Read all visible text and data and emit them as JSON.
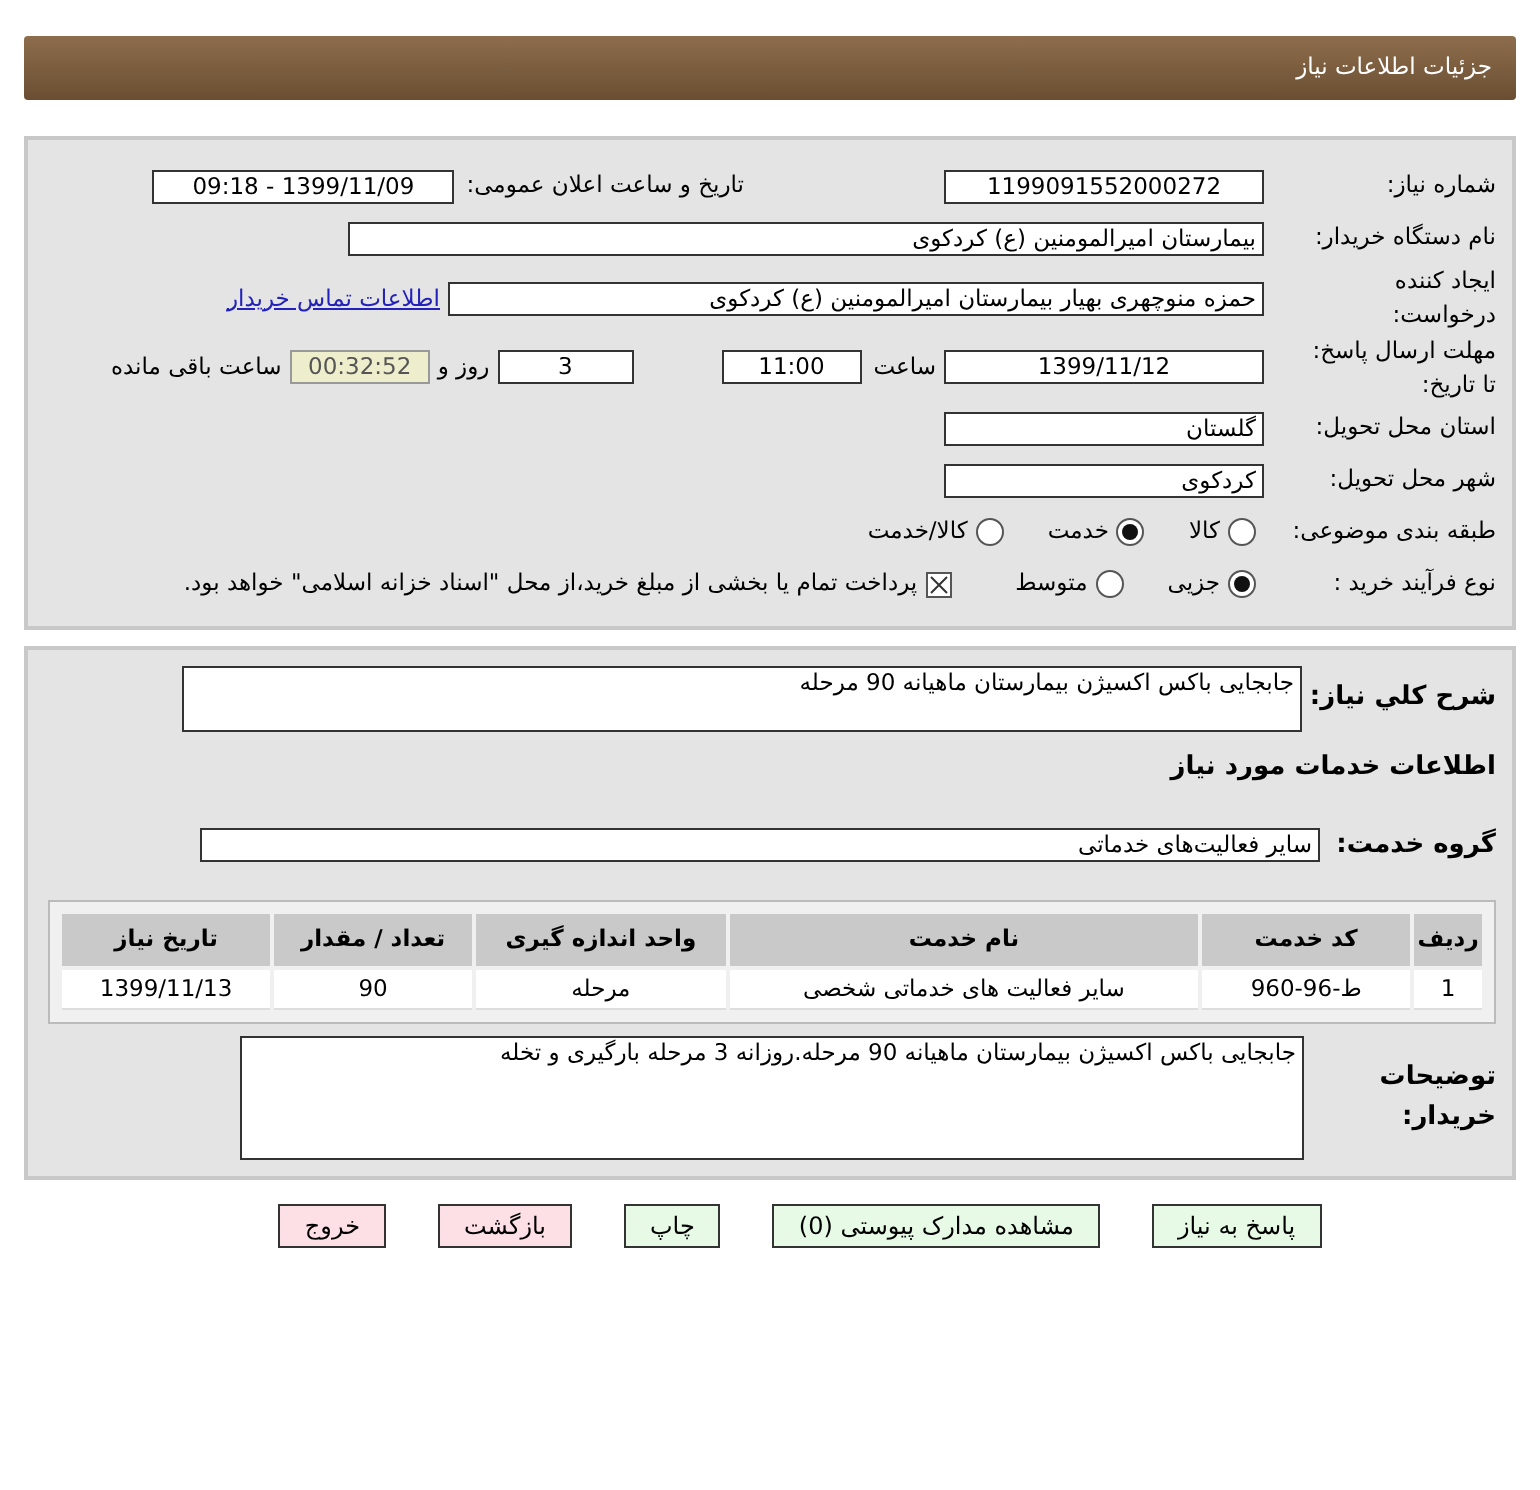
{
  "header": {
    "title": "جزئیات اطلاعات نیاز"
  },
  "need_number": {
    "label": "شماره نیاز:",
    "value": "1199091552000272"
  },
  "announce_date": {
    "label": "تاریخ و ساعت اعلان عمومی:",
    "value": "1399/11/09 - 09:18"
  },
  "buyer_org": {
    "label": "نام دستگاه خریدار:",
    "value": "بیمارستان امیرالمومنین (ع) کردکوی"
  },
  "requester": {
    "label_lines": [
      "ایجاد کننده",
      "درخواست:"
    ],
    "value": "حمزه  منوچهری بهیار بیمارستان امیرالمومنین (ع) کردکوی",
    "link": "اطلاعات تماس خریدار"
  },
  "deadline": {
    "label_lines": [
      "مهلت ارسال پاسخ:",
      "تا تاریخ:"
    ],
    "date": "1399/11/12",
    "time_label": "ساعت",
    "time": "11:00",
    "days": "3",
    "days_label": "روز و",
    "remaining": "00:32:52",
    "remaining_label": "ساعت باقی مانده"
  },
  "province": {
    "label": "استان محل تحویل:",
    "value": "گلستان"
  },
  "city": {
    "label": "شهر محل تحویل:",
    "value": "کردکوی"
  },
  "category": {
    "label": "طبقه بندی موضوعی:",
    "options": [
      {
        "label": "کالا",
        "selected": false
      },
      {
        "label": "خدمت",
        "selected": true
      },
      {
        "label": "کالا/خدمت",
        "selected": false
      }
    ]
  },
  "process": {
    "label": "نوع فرآیند خرید :",
    "options": [
      {
        "label": "جزیی",
        "selected": true
      },
      {
        "label": "متوسط",
        "selected": false
      }
    ],
    "payment": {
      "checked": true,
      "text": "پرداخت تمام یا بخشی از مبلغ خرید،از محل \"اسناد خزانه اسلامی\" خواهد بود."
    }
  },
  "description": {
    "label": "شرح كلي نياز:",
    "value": "جابجایی باکس اکسیژن بیمارستان ماهیانه 90 مرحله"
  },
  "services_heading": "اطلاعات خدمات مورد نیاز",
  "service_group": {
    "label": "گروه خدمت:",
    "value": "سایر فعالیت‌های خدماتی"
  },
  "table": {
    "columns": [
      "ردیف",
      "کد خدمت",
      "نام خدمت",
      "واحد اندازه گیری",
      "تعداد / مقدار",
      "تاریخ نیاز"
    ],
    "rows": [
      [
        "1",
        "ط-96-960",
        "سایر فعالیت های خدماتی شخصی",
        "مرحله",
        "90",
        "1399/11/13"
      ]
    ]
  },
  "buyer_notes": {
    "label": "توضیحات خریدار:",
    "value": "جابجایی باکس اکسیژن بیمارستان ماهیانه 90 مرحله.روزانه 3 مرحله بارگیری و تخله"
  },
  "buttons": [
    {
      "label": "پاسخ به نیاز",
      "kind": "normal"
    },
    {
      "label": "مشاهده مدارک پیوستی (0)",
      "kind": "normal"
    },
    {
      "label": "چاپ",
      "kind": "normal"
    },
    {
      "label": "بازگشت",
      "kind": "danger"
    },
    {
      "label": "خروج",
      "kind": "danger"
    }
  ]
}
